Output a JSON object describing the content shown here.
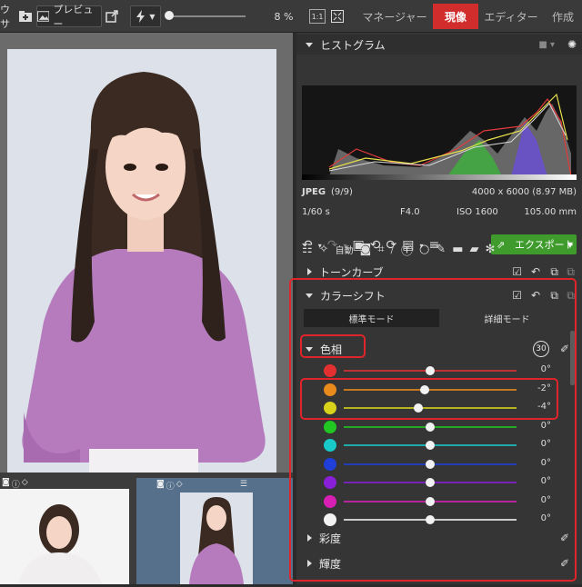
{
  "toolbar": {
    "left_text": "ウサ",
    "preview_label": "プレビュー",
    "zoom": "8 %",
    "mode_tabs": [
      "マネージャー",
      "現像",
      "エディター",
      "作成"
    ]
  },
  "histogram": {
    "title": "ヒストグラム",
    "format": "JPEG",
    "index": "(9/9)",
    "dimensions": "4000 x 6000 (8.97 MB)",
    "shutter": "1/60 s",
    "aperture": "F4.0",
    "iso": "ISO 1600",
    "focal": "105.00 mm"
  },
  "toolbar2": {
    "auto_label": "自動",
    "export_label": "エクスポート"
  },
  "sections": {
    "tone_curve": "トーンカーブ",
    "color_shift": "カラーシフト",
    "standard_mode": "標準モード",
    "detail_mode": "詳細モード",
    "hue": "色相",
    "saturation": "彩度",
    "luminance": "輝度",
    "badge_30": "30"
  },
  "hue_rows": [
    {
      "color": "#e23030",
      "value": "0°",
      "knob": 0.5
    },
    {
      "color": "#e88a1c",
      "value": "-2°",
      "knob": 0.47
    },
    {
      "color": "#d8d21a",
      "value": "-4°",
      "knob": 0.43
    },
    {
      "color": "#22c622",
      "value": "0°",
      "knob": 0.5
    },
    {
      "color": "#19c9c9",
      "value": "0°",
      "knob": 0.5
    },
    {
      "color": "#1f3fd8",
      "value": "0°",
      "knob": 0.5
    },
    {
      "color": "#8a1fd8",
      "value": "0°",
      "knob": 0.5
    },
    {
      "color": "#d81fb4",
      "value": "0°",
      "knob": 0.5
    },
    {
      "color": "#f2f2f2",
      "value": "0°",
      "knob": 0.5
    }
  ]
}
